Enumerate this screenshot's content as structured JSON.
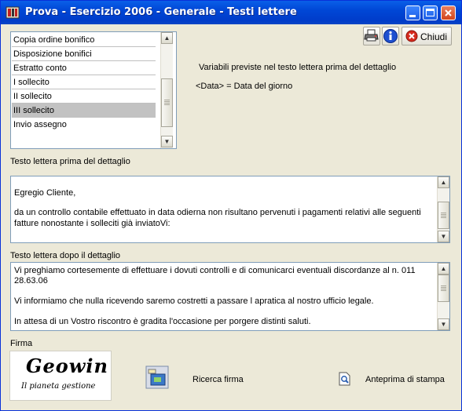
{
  "window": {
    "title": "Prova - Esercizio 2006 - Generale - Testi lettere"
  },
  "toolbar": {
    "close_label": "Chiudi"
  },
  "list": {
    "items": [
      "Copia ordine bonifico",
      "Disposizione bonifici",
      "Estratto conto",
      "I sollecito",
      "II sollecito",
      "III sollecito",
      "Invio assegno"
    ],
    "selected": "III sollecito"
  },
  "variables": {
    "heading": "Variabili previste nel testo lettera prima del dettaglio",
    "data_var": "<Data> = Data del giorno"
  },
  "before_detail": {
    "label": "Testo lettera prima del dettaglio",
    "lines": [
      "Egregio Cliente,",
      "",
      "da un controllo contabile effettuato in data odierna non risultano pervenuti i pagamenti relativi alle  seguenti",
      "fatture nonostante i solleciti già inviatoVi:"
    ]
  },
  "after_detail": {
    "label": "Testo lettera dopo il dettaglio",
    "lines": [
      "Vi  preghiamo  cortesemente  di effettuare i dovuti controlli e di comunicarci eventuali discordanze al n. 011",
      "28.63.06",
      "",
      "Vi informiamo che nulla ricevendo saremo costretti a passare l apratica al nostro ufficio  legale.",
      "",
      "In  attesa  di  un  Vostro  riscontro è gradita  l'occasione  per porgere distinti saluti."
    ]
  },
  "signature": {
    "label": "Firma",
    "logo_title": "Geowin",
    "logo_sub": "Il pianeta gestione",
    "search_label": "Ricerca firma",
    "preview_label": "Anteprima di stampa"
  }
}
